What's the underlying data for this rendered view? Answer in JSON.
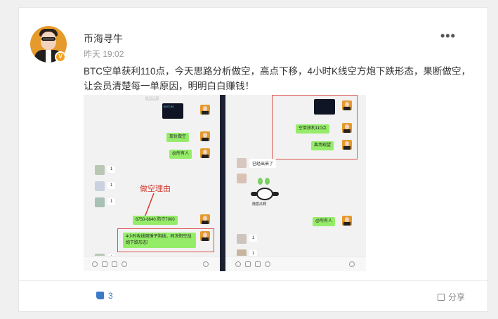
{
  "post": {
    "author": "币海寻牛",
    "time": "昨天 19:02",
    "more": "•••",
    "text": "BTC空单获利110点，今天思路分析做空，高点下移，4小时K线空方炮下跌形态，果断做空，让会员清楚每一单原因，明明白白赚钱！",
    "badge": "V"
  },
  "screenshot": {
    "left": {
      "timestamp": "12:54",
      "msgs": [
        "现价做空",
        "@所有人",
        "1",
        "1",
        "1",
        "6750-6640 防守7000",
        "4小时收线倒锤子阴线，同决阳空战炮下跌形态！",
        "1"
      ],
      "annotation": "做空理由",
      "chart_text": "6872.00"
    },
    "right": {
      "msgs": [
        "空单获利110点",
        "离场观望",
        "已经出来了",
        "@所有人",
        "1",
        "1"
      ],
      "sticker_caption": "随意瓜啊"
    }
  },
  "footer": {
    "likes": "3",
    "share": "分享"
  }
}
